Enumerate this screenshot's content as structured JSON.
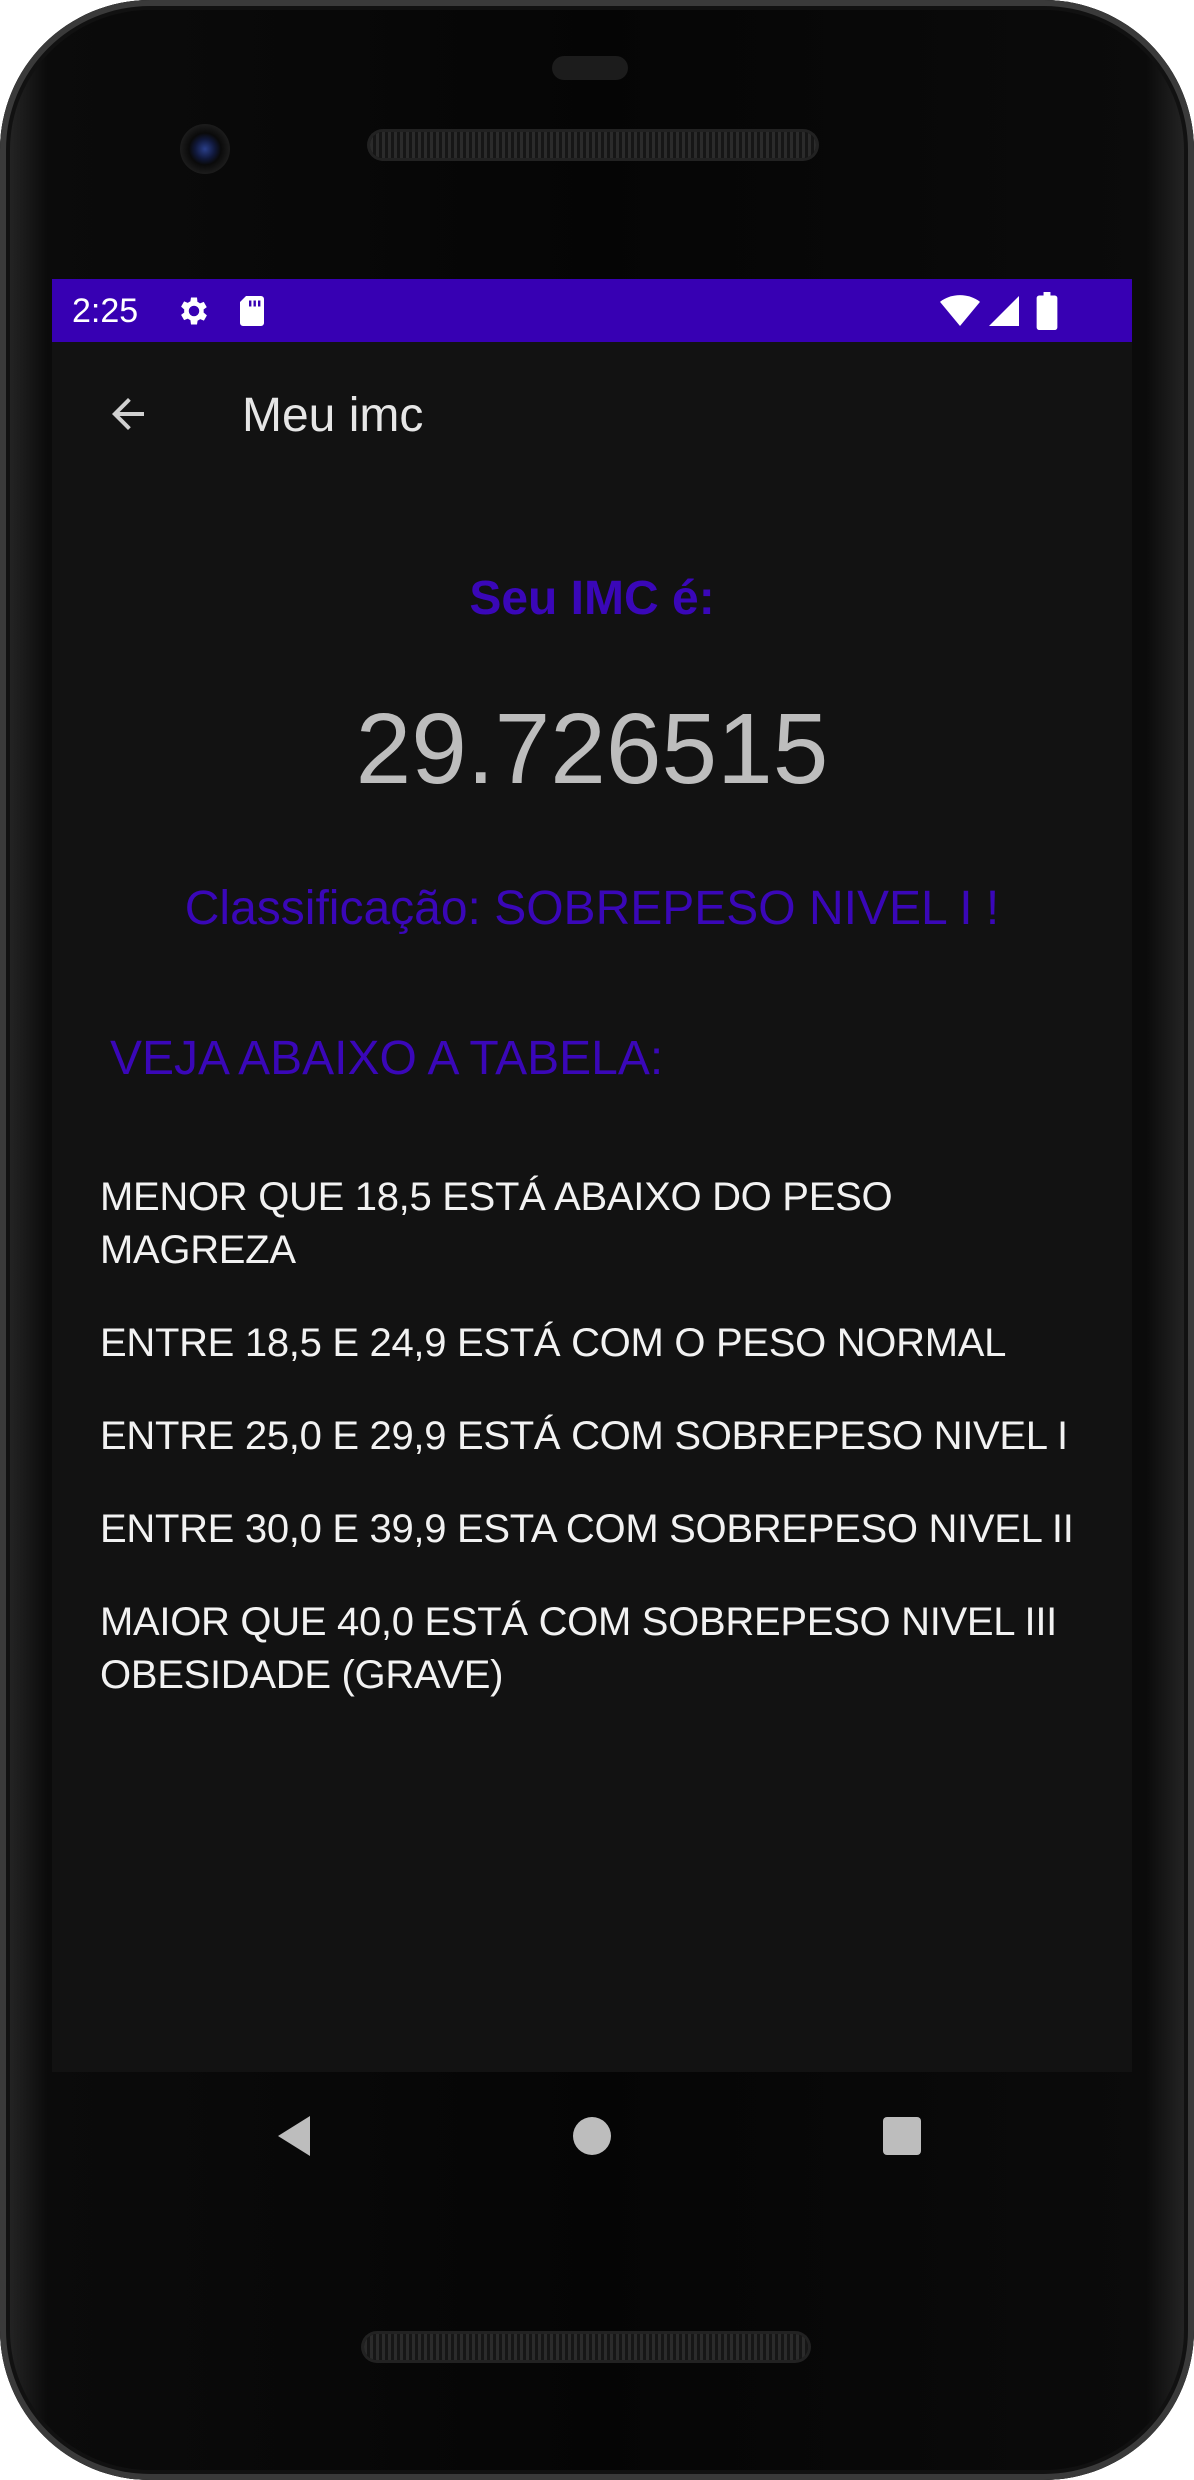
{
  "status_bar": {
    "time": "2:25",
    "left_icons": [
      "gear-icon",
      "sd-card-icon"
    ],
    "right_icons": [
      "wifi-icon",
      "cell-signal-icon",
      "battery-icon"
    ],
    "color": "#3700b3"
  },
  "app_bar": {
    "back_icon": "arrow-back-icon",
    "title": "Meu imc"
  },
  "result": {
    "label": "Seu IMC é:",
    "value": "29.726515",
    "classification": "Classificação: SOBREPESO NIVEL I !"
  },
  "table": {
    "title": "VEJA ABAIXO A TABELA:",
    "rows": [
      "MENOR QUE 18,5 ESTÁ ABAIXO DO PESO\nMAGREZA",
      "ENTRE 18,5 E 24,9 ESTÁ COM O PESO NORMAL",
      "ENTRE 25,0 E 29,9 ESTÁ COM SOBREPESO NIVEL I",
      "ENTRE 30,0 E 39,9 ESTA COM SOBREPESO NIVEL II",
      "MAIOR QUE 40,0 ESTÁ COM SOBREPESO NIVEL III\nOBESIDADE (GRAVE)"
    ]
  },
  "nav_bar": {
    "buttons": [
      "back-triangle-icon",
      "home-circle-icon",
      "recents-square-icon"
    ]
  },
  "colors": {
    "accent": "#3700b3",
    "background": "#121212",
    "value_text": "#bdbdbd",
    "body_text": "#f2f2f2"
  }
}
